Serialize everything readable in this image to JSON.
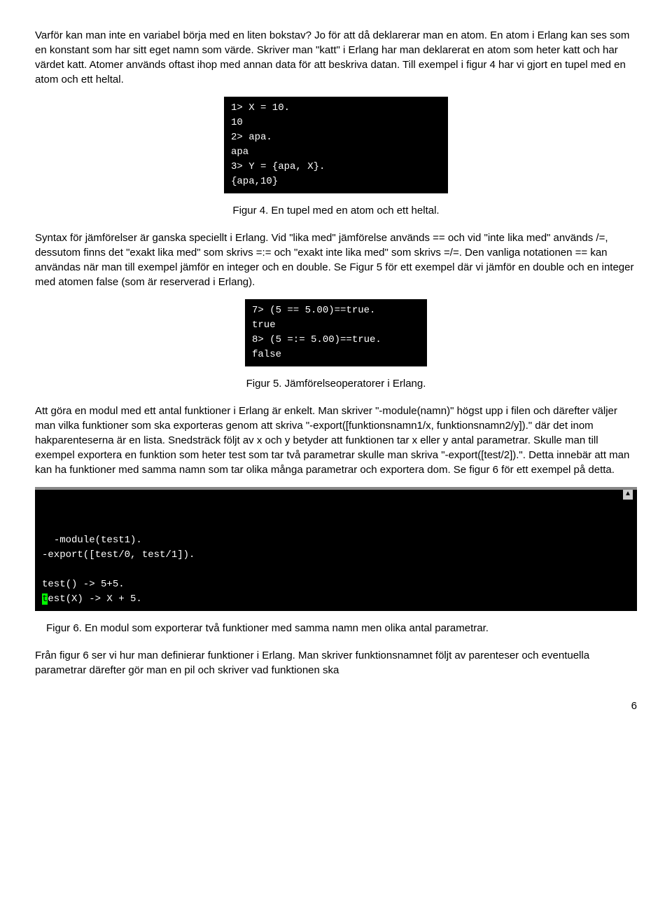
{
  "para1": "Varför kan man inte en variabel börja med en liten bokstav? Jo för att då deklarerar man en atom. En atom i Erlang kan ses som en konstant som har sitt eget namn som värde. Skriver man \"katt\" i Erlang har man deklarerat en atom som heter katt och har värdet katt. Atomer används oftast ihop med annan data för att beskriva datan. Till exempel i figur 4 har vi gjort en tupel med en atom och ett heltal.",
  "code1": "1> X = 10.\n10\n2> apa.\napa\n3> Y = {apa, X}.\n{apa,10}",
  "caption1": "Figur 4. En tupel med en atom och ett heltal.",
  "para2": "Syntax för jämförelser är ganska speciellt i Erlang. Vid \"lika med\" jämförelse används == och vid \"inte lika med\" används /=, dessutom finns det \"exakt lika med\" som skrivs =:= och \"exakt inte lika med\" som skrivs =/=. Den vanliga notationen == kan användas när man till exempel jämför en integer och en double. Se Figur 5 för ett exempel där vi jämför en double och en integer med atomen false (som är reserverad i Erlang).",
  "code2": "7> (5 == 5.00)==true.\ntrue\n8> (5 =:= 5.00)==true.\nfalse",
  "caption2": "Figur 5. Jämförelseoperatorer i Erlang.",
  "para3": "Att göra en modul med ett antal funktioner i Erlang är enkelt. Man skriver \"-module(namn)\" högst upp i filen och därefter väljer man vilka funktioner som ska exporteras genom att skriva \"-export([funktionsnamn1/x, funktionsnamn2/y]).\" där det inom hakparenteserna är en lista. Snedsträck följt av x och y betyder att funktionen tar x eller y antal parametrar. Skulle man till exempel exportera en funktion som heter test som tar två parametrar skulle man skriva \"-export([test/2]).\". Detta innebär att man kan ha funktioner med samma namn som tar olika många parametrar och exportera dom. Se figur 6 för ett exempel på detta.",
  "code3_prefix": "-module(test1).\n-export([test/0, test/1]).\n\ntest() -> 5+5.\n",
  "code3_cursor": "t",
  "code3_suffix": "est(X) -> X + 5.",
  "caption3": "Figur 6. En modul som exporterar två funktioner med samma namn men olika antal parametrar.",
  "para4": "Från figur 6 ser vi hur man definierar funktioner i Erlang. Man skriver funktionsnamnet följt av parenteser och eventuella parametrar därefter gör man en pil och skriver vad funktionen ska",
  "page_number": "6"
}
